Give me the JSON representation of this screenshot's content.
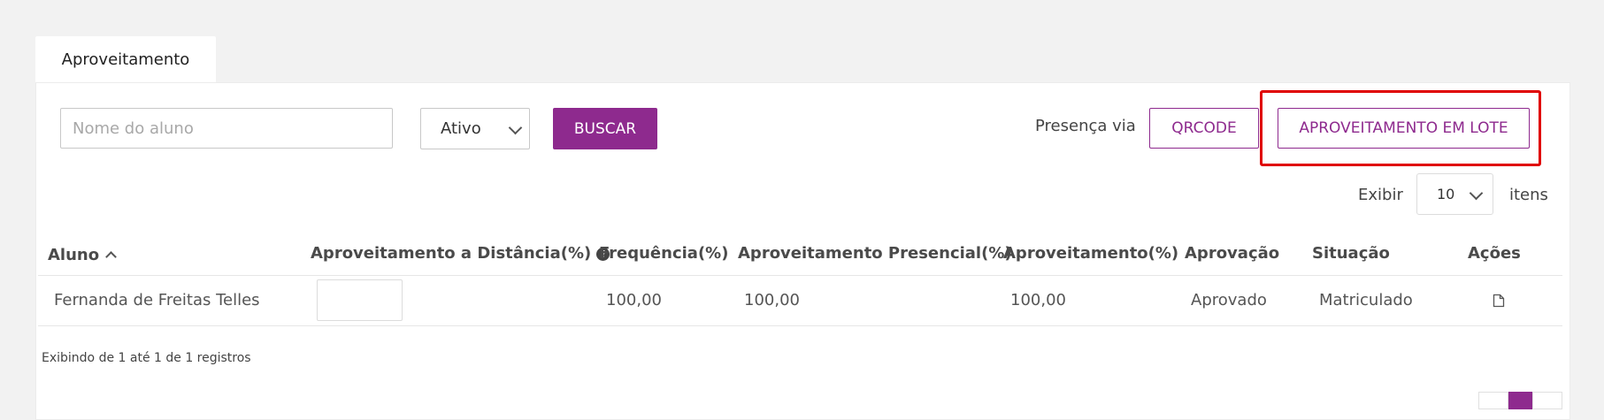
{
  "tab": {
    "label": "Aproveitamento"
  },
  "filters": {
    "search_placeholder": "Nome do aluno",
    "status_value": "Ativo",
    "search_button": "BUSCAR"
  },
  "actions": {
    "presenca_label": "Presença via",
    "qrcode_button": "QRCODE",
    "lote_button": "APROVEITAMENTO EM LOTE"
  },
  "page_size": {
    "label_before": "Exibir",
    "value": "10",
    "label_after": "itens"
  },
  "table": {
    "headers": {
      "aluno": "Aluno",
      "aprov_distancia": "Aproveitamento a Distância(%)",
      "frequencia": "Frequência(%)",
      "aprov_presencial": "Aproveitamento Presencial(%)",
      "aproveitamento": "Aproveitamento(%)",
      "aprovacao": "Aprovação",
      "situacao": "Situação",
      "acoes": "Ações"
    },
    "rows": [
      {
        "aluno": "Fernanda de Freitas Telles",
        "aprov_distancia": "",
        "frequencia": "100,00",
        "aprov_presencial": "100,00",
        "aproveitamento": "100,00",
        "aprovacao": "Aprovado",
        "situacao": "Matriculado"
      }
    ]
  },
  "records_info": "Exibindo de 1 até 1 de 1 registros",
  "colors": {
    "accent": "#8e2a8e",
    "highlight": "#e00000"
  },
  "icons": {
    "sort": "chevron-up-icon",
    "help": "question-circle-icon",
    "action": "document-icon"
  }
}
